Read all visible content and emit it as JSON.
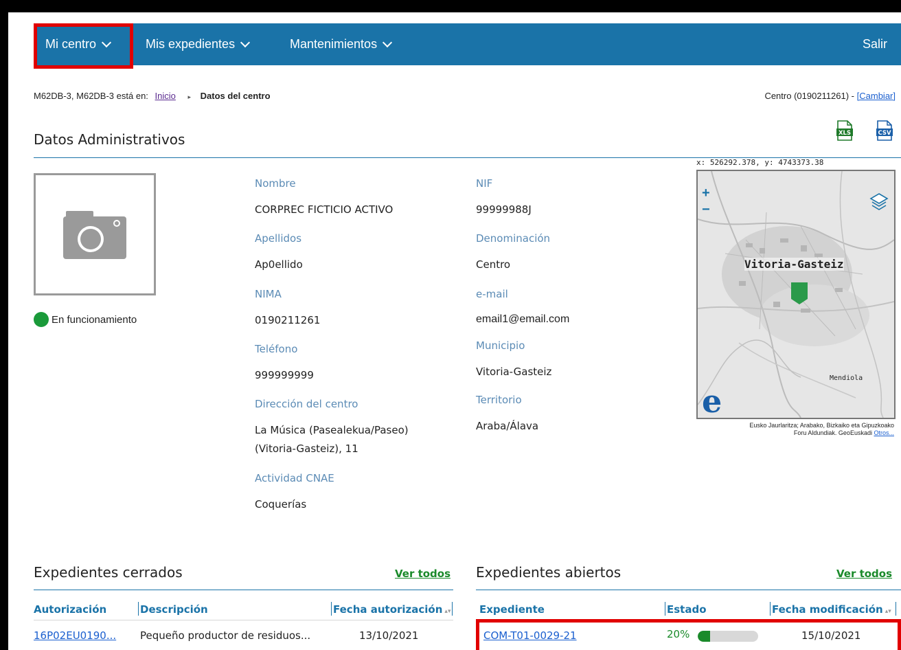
{
  "nav": {
    "items": [
      {
        "label": "Mi centro"
      },
      {
        "label": "Mis expedientes"
      },
      {
        "label": "Mantenimientos"
      }
    ],
    "logout": "Salir"
  },
  "breadcrumb": {
    "user_text": "M62DB-3, M62DB-3 está en:",
    "home": "Inicio",
    "current": "Datos del centro"
  },
  "centro": {
    "text": "Centro (0190211261) -",
    "change": "[Cambiar]"
  },
  "admin": {
    "title": "Datos Administrativos",
    "export_xls": "XLS",
    "export_csv": "CSV",
    "status": "En funcionamiento",
    "fields": {
      "nombre_label": "Nombre",
      "nombre": "CORPREC FICTICIO ACTIVO",
      "apellidos_label": "Apellidos",
      "apellidos": "Ap0ellido",
      "nima_label": "NIMA",
      "nima": "0190211261",
      "telefono_label": "Teléfono",
      "telefono": "999999999",
      "direccion_label": "Dirección del centro",
      "direccion_1": "La Música (Pasealekua/Paseo)",
      "direccion_2": "(Vitoria-Gasteiz), 11",
      "cnae_label": "Actividad CNAE",
      "cnae": "Coquerías",
      "nif_label": "NIF",
      "nif": "99999988J",
      "denominacion_label": "Denominación",
      "denominacion": "Centro",
      "email_label": "e-mail",
      "email": "email1@email.com",
      "municipio_label": "Municipio",
      "municipio": "Vitoria-Gasteiz",
      "territorio_label": "Territorio",
      "territorio": "Araba/Álava"
    }
  },
  "map": {
    "coords": "x: 526292.378, y: 4743373.38",
    "city": "Vitoria-Gasteiz",
    "district": "Mendiola",
    "zoom_in": "+",
    "zoom_out": "−",
    "logo": "e",
    "credit_1": "Eusko Jaurlaritza; Arabako, Bizkaiko eta Gipuzkoako",
    "credit_2": "Foru Aldundiak. GeoEuskadi",
    "credit_link": "Otros..."
  },
  "closed": {
    "title": "Expedientes cerrados",
    "see_all": "Ver todos",
    "headers": [
      "Autorización",
      "Descripción",
      "Fecha autorización"
    ],
    "rows": [
      {
        "autorizacion": "16P02EU0190...",
        "descripcion": "Pequeño productor de residuos...",
        "fecha": "13/10/2021"
      }
    ]
  },
  "open": {
    "title": "Expedientes abiertos",
    "see_all": "Ver todos",
    "headers": [
      "Expediente",
      "Estado",
      "Fecha modificación"
    ],
    "rows": [
      {
        "expediente": "COM-T01-0029-21",
        "estado": "20%",
        "progress": 0.2,
        "fecha": "15/10/2021"
      }
    ]
  },
  "colors": {
    "nav": "#1a73a8",
    "label": "#5b8bb5",
    "link": "#1a5fcf",
    "accent_green": "#1a8a2a",
    "highlight": "#e10000"
  }
}
